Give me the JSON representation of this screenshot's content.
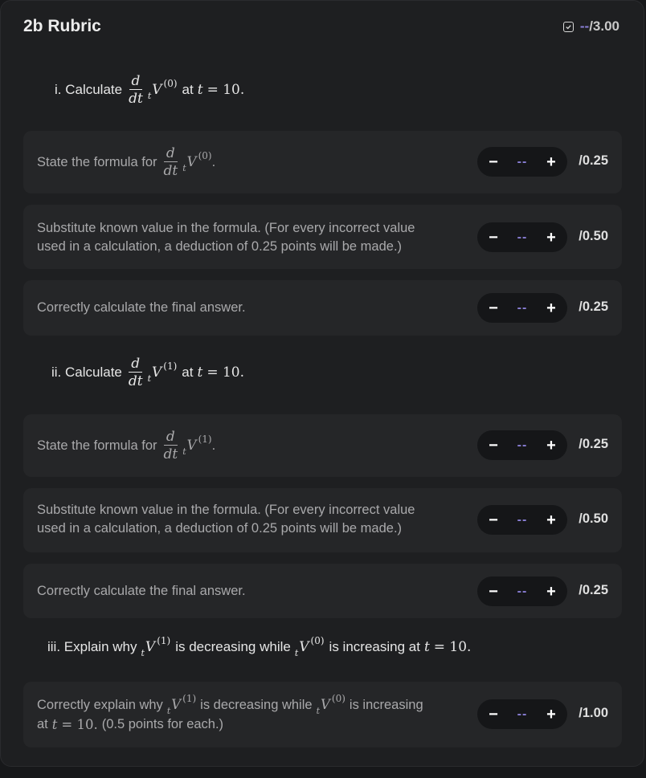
{
  "header": {
    "title": "2b Rubric",
    "score_dash": "--",
    "score_total": "/3.00"
  },
  "sections": [
    {
      "prefix": "i. Calculate",
      "frac_num": "d",
      "frac_den": "dt",
      "sub": "t",
      "var": "V",
      "sup": "(0)",
      "mid": "at",
      "tvar": "t",
      "eq": "= 10.",
      "items": [
        {
          "text_prefix": "State the formula for",
          "frac_num": "d",
          "frac_den": "dt",
          "sub": "t",
          "var": "V",
          "sup": "(0)",
          "text_suffix": ".",
          "value": "--",
          "max": "/0.25"
        },
        {
          "line1": "Substitute known value in the formula. (For every incorrect value",
          "line2": "used in a calculation, a deduction of 0.25 points will be made.)",
          "value": "--",
          "max": "/0.50"
        },
        {
          "text": "Correctly calculate the final answer.",
          "value": "--",
          "max": "/0.25"
        }
      ]
    },
    {
      "prefix": "ii. Calculate",
      "frac_num": "d",
      "frac_den": "dt",
      "sub": "t",
      "var": "V",
      "sup": "(1)",
      "mid": "at",
      "tvar": "t",
      "eq": "= 10.",
      "items": [
        {
          "text_prefix": "State the formula for",
          "frac_num": "d",
          "frac_den": "dt",
          "sub": "t",
          "var": "V",
          "sup": "(1)",
          "text_suffix": ".",
          "value": "--",
          "max": "/0.25"
        },
        {
          "line1": "Substitute known value in the formula. (For every incorrect value",
          "line2": "used in a calculation, a deduction of 0.25 points will be made.)",
          "value": "--",
          "max": "/0.50"
        },
        {
          "text": "Correctly calculate the final answer.",
          "value": "--",
          "max": "/0.25"
        }
      ]
    },
    {
      "prefix": "iii. Explain why",
      "sub1": "t",
      "var1": "V",
      "sup1": "(1)",
      "mid1": "is decreasing while",
      "sub2": "t",
      "var2": "V",
      "sup2": "(0)",
      "mid2": "is increasing at",
      "tvar": "t",
      "eq": "= 10.",
      "items": [
        {
          "l1_a": "Correctly explain why",
          "sub1": "t",
          "var1": "V",
          "sup1": "(1)",
          "l1_b": "is decreasing while",
          "sub2": "t",
          "var2": "V",
          "sup2": "(0)",
          "l1_c": "is increasing",
          "l2_a": "at",
          "tvar": "t",
          "eq": "= 10.",
          "l2_b": "(0.5 points for each.)",
          "value": "--",
          "max": "/1.00"
        }
      ]
    }
  ],
  "controls": {
    "minus": "−",
    "plus": "+"
  },
  "icons": {
    "header_icon": "checkbox-icon"
  }
}
